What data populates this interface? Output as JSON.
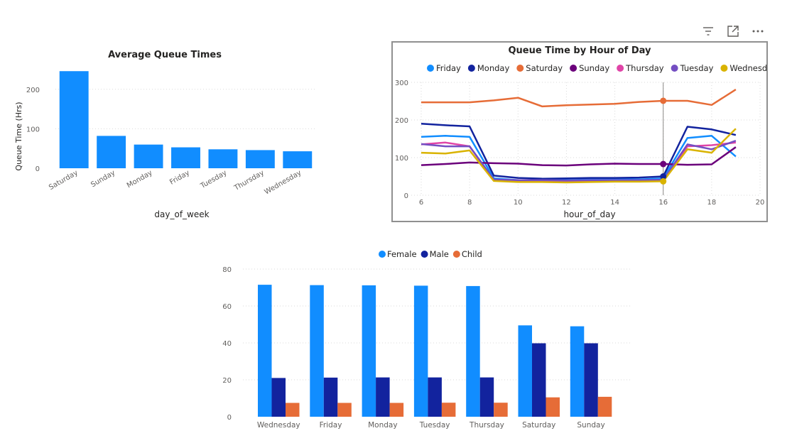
{
  "visual_header": {
    "icons": [
      "filter-icon",
      "focus-mode-icon",
      "more-options-icon"
    ]
  },
  "colors": {
    "Friday": "#118DFF",
    "Monday": "#12239E",
    "Saturday": "#E66C37",
    "Sunday": "#6B007B",
    "Thursday": "#E044A7",
    "Tuesday": "#744EC2",
    "Wednesday": "#D9B300",
    "Female": "#118DFF",
    "Male": "#12239E",
    "Child": "#E66C37",
    "bar": "#118DFF",
    "grid": "#D9D9D9",
    "axis_text": "#605E5C"
  },
  "chart_data": [
    {
      "type": "bar",
      "title": "Average Queue Times",
      "xlabel": "day_of_week",
      "ylabel": "Queue Time (Hrs)",
      "categories": [
        "Saturday",
        "Sunday",
        "Monday",
        "Friday",
        "Tuesday",
        "Thursday",
        "Wednesday"
      ],
      "values": [
        246,
        82,
        60,
        53,
        48,
        46,
        43
      ],
      "ylim": [
        0,
        250
      ],
      "yticks": [
        0,
        100,
        200
      ],
      "grid": true
    },
    {
      "type": "line",
      "title": "Queue Time by Hour of Day",
      "xlabel": "hour_of_day",
      "ylabel": "",
      "xlim": [
        6,
        20
      ],
      "ylim": [
        0,
        300
      ],
      "xticks": [
        6,
        8,
        10,
        12,
        14,
        16,
        18,
        20
      ],
      "yticks": [
        0,
        100,
        200,
        300
      ],
      "legend": "top-center",
      "grid": true,
      "hover_x": 16,
      "x": [
        6,
        7,
        8,
        9,
        10,
        11,
        12,
        13,
        14,
        15,
        16,
        17,
        18,
        19
      ],
      "series": [
        {
          "name": "Friday",
          "values": [
            155,
            158,
            155,
            45,
            40,
            40,
            40,
            42,
            42,
            42,
            45,
            152,
            158,
            103
          ]
        },
        {
          "name": "Monday",
          "values": [
            190,
            186,
            183,
            52,
            46,
            44,
            45,
            46,
            46,
            47,
            50,
            182,
            175,
            160
          ]
        },
        {
          "name": "Saturday",
          "values": [
            247,
            247,
            247,
            252,
            259,
            236,
            239,
            241,
            243,
            248,
            251,
            251,
            240,
            281
          ]
        },
        {
          "name": "Sunday",
          "values": [
            80,
            83,
            87,
            85,
            84,
            80,
            79,
            82,
            84,
            83,
            83,
            81,
            82,
            128
          ]
        },
        {
          "name": "Thursday",
          "values": [
            135,
            140,
            130,
            40,
            37,
            37,
            37,
            38,
            38,
            38,
            40,
            130,
            133,
            140
          ]
        },
        {
          "name": "Tuesday",
          "values": [
            136,
            130,
            130,
            42,
            40,
            40,
            39,
            40,
            40,
            40,
            41,
            135,
            122,
            145
          ]
        },
        {
          "name": "Wednesday",
          "values": [
            113,
            111,
            119,
            38,
            35,
            35,
            34,
            35,
            36,
            36,
            37,
            122,
            113,
            177
          ]
        }
      ]
    },
    {
      "type": "bar",
      "title": "",
      "xlabel": "",
      "ylabel": "",
      "categories": [
        "Wednesday",
        "Friday",
        "Monday",
        "Tuesday",
        "Thursday",
        "Saturday",
        "Sunday"
      ],
      "ylim": [
        0,
        80
      ],
      "yticks": [
        0,
        20,
        40,
        60,
        80
      ],
      "legend": "top-center",
      "grid": true,
      "series": [
        {
          "name": "Female",
          "values": [
            71.5,
            71.3,
            71.2,
            71,
            70.8,
            49.5,
            49
          ]
        },
        {
          "name": "Male",
          "values": [
            21,
            21.2,
            21.3,
            21.3,
            21.3,
            39.8,
            39.8
          ]
        },
        {
          "name": "Child",
          "values": [
            7.5,
            7.5,
            7.5,
            7.6,
            7.6,
            10.5,
            10.8
          ]
        }
      ]
    }
  ]
}
